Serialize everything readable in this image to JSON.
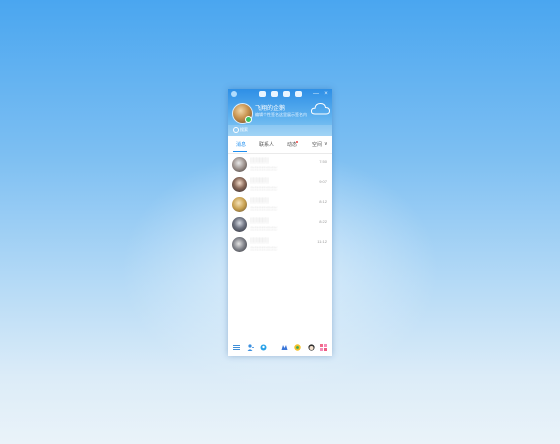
{
  "header": {
    "nickname": "飞翔的企鹅",
    "signature": "编辑个性签名这里展示签名内容",
    "search_placeholder": "搜索"
  },
  "topbar": {
    "icons": [
      "qq-logo-icon",
      "weather-icon",
      "skin-icon",
      "app-icon",
      "game-icon"
    ],
    "minimize": "—",
    "close": "×"
  },
  "tabs": [
    {
      "label": "消息",
      "active": true
    },
    {
      "label": "联系人",
      "active": false
    },
    {
      "label": "动态",
      "active": false
    },
    {
      "label": "空间",
      "active": false
    }
  ],
  "tab_more": "∨",
  "conversations": [
    {
      "name": "░░░░░░",
      "preview": "░░░░░░░░░░░",
      "time": "7:50"
    },
    {
      "name": "░░░░░░",
      "preview": "░░░░░░░░░░░",
      "time": "9:07"
    },
    {
      "name": "░░░░░░",
      "preview": "░░░░░░░░░░░",
      "time": "8:12"
    },
    {
      "name": "░░░░░░",
      "preview": "░░░░░░░░░░░",
      "time": "8:22"
    },
    {
      "name": "░░░░░░",
      "preview": "░░░░░░░░░░░",
      "time": "11:12"
    }
  ],
  "bottom_icons": [
    "menu-icon",
    "add-friend-icon",
    "contacts-icon",
    "zone-icon",
    "game-center-icon",
    "avatar-shop-icon",
    "apps-icon"
  ],
  "colors": {
    "accent": "#1e8ef0",
    "header_top": "#2e8fe6",
    "online": "#38c160",
    "badge": "#f04141"
  }
}
